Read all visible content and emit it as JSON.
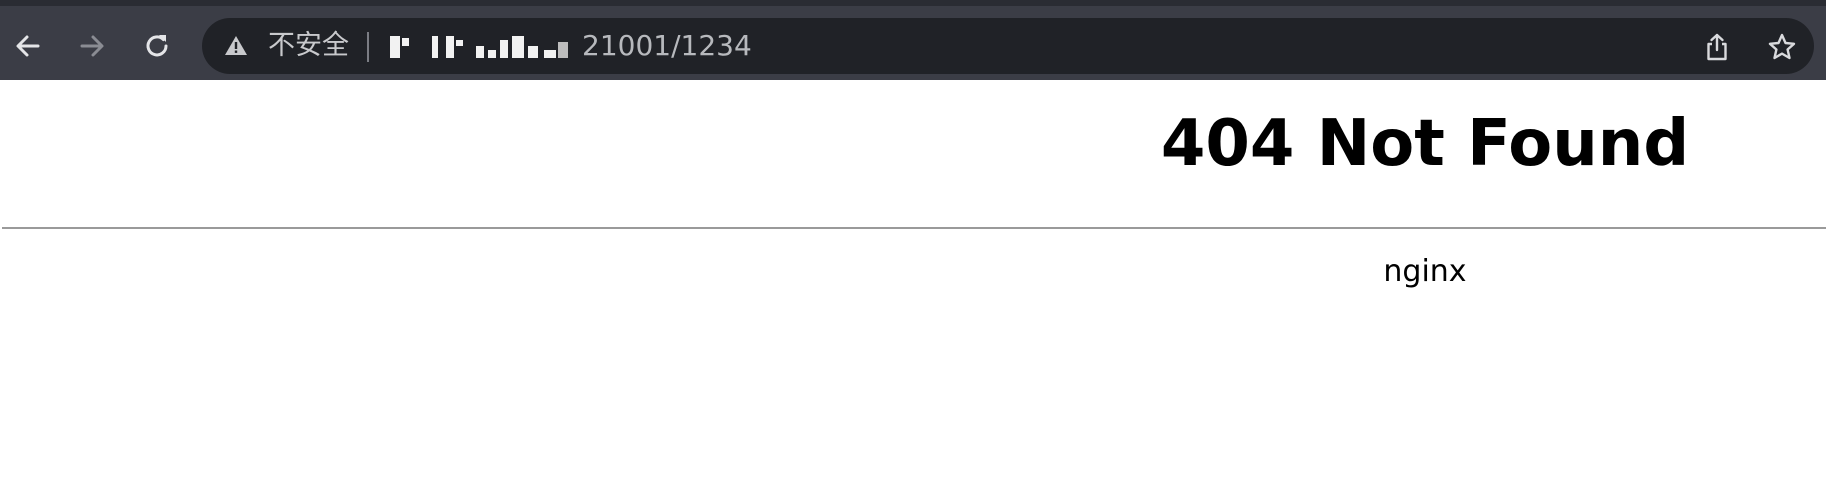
{
  "browser": {
    "nav": {
      "back_icon": "arrow-left-icon",
      "forward_icon": "arrow-right-icon",
      "reload_icon": "reload-icon"
    },
    "address_bar": {
      "security_icon": "warning-triangle-icon",
      "security_label": "不安全",
      "host_redacted": true,
      "url_visible": "21001/1234",
      "share_icon": "share-icon",
      "bookmark_icon": "star-icon"
    },
    "colors": {
      "toolbar_bg": "#3b3d46",
      "omnibox_bg": "#202227",
      "icon_color": "#d9dadd",
      "disabled_icon_color": "#8a8c93"
    }
  },
  "page": {
    "title": "404 Not Found",
    "server": "nginx",
    "background": "#ffffff"
  }
}
